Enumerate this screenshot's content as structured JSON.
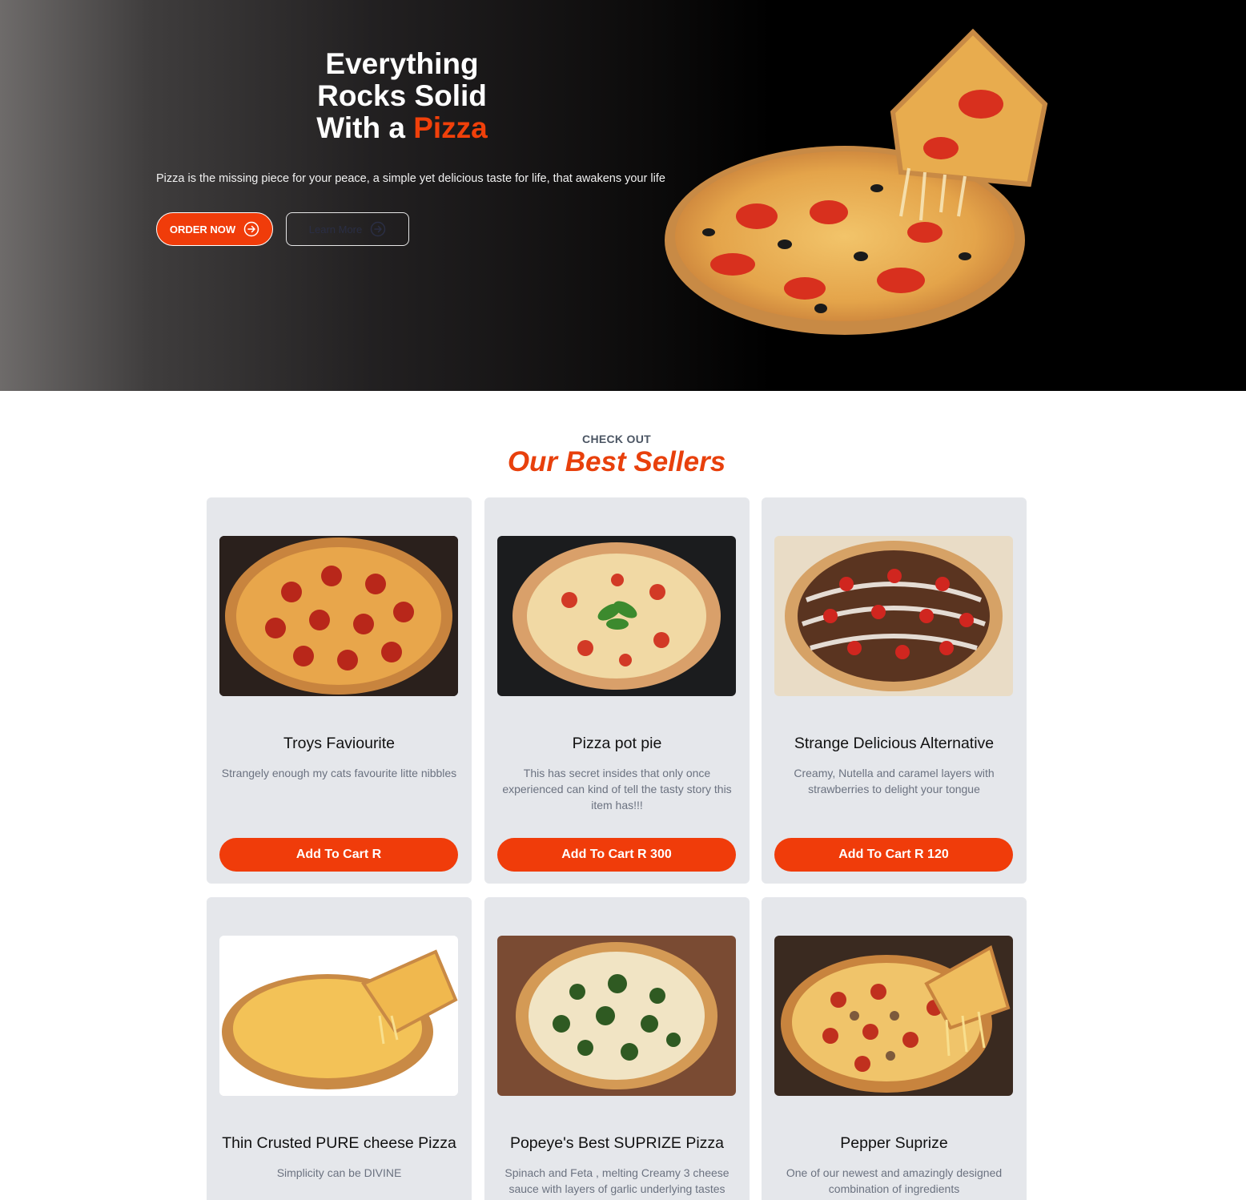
{
  "hero": {
    "title_line1": "Everything",
    "title_line2": "Rocks Solid",
    "title_line3_prefix": "With a ",
    "title_line3_accent": "Pizza",
    "subtitle": "Pizza is the missing piece for your peace, a simple yet delicious taste for life, that awakens your life",
    "order_button": "ORDER NOW",
    "learn_button": "Learn More"
  },
  "best_sellers": {
    "eyebrow": "CHECK OUT",
    "title": "Our Best Sellers",
    "products": [
      {
        "name": "Troys Faviourite",
        "description": "Strangely enough my cats favourite litte nibbles",
        "button": "Add To Cart R",
        "image": "pepperoni-pizza-image"
      },
      {
        "name": "Pizza pot pie",
        "description": "This has secret insides that only once experienced can kind of tell the tasty story this item has!!!",
        "button": "Add To Cart R 300",
        "image": "margherita-pizza-image"
      },
      {
        "name": "Strange Delicious Alternative",
        "description": "Creamy, Nutella and caramel layers with strawberries to delight your tongue",
        "button": "Add To Cart R 120",
        "image": "strawberry-nutella-pizza-image"
      },
      {
        "name": "Thin Crusted PURE cheese Pizza",
        "description": "Simplicity can be DIVINE",
        "button": "",
        "image": "cheese-pizza-image"
      },
      {
        "name": "Popeye's Best SUPRIZE Pizza",
        "description": "Spinach and Feta , melting Creamy 3 cheese sauce with layers of garlic underlying tastes",
        "button": "",
        "image": "spinach-pizza-image"
      },
      {
        "name": "Pepper Suprize",
        "description": "One of our newest and amazingly designed combination of ingredients",
        "button": "",
        "image": "pepper-pizza-image"
      }
    ]
  },
  "colors": {
    "accent": "#f03c0a",
    "card_background": "#e5e7eb",
    "muted_text": "#6b7280"
  }
}
